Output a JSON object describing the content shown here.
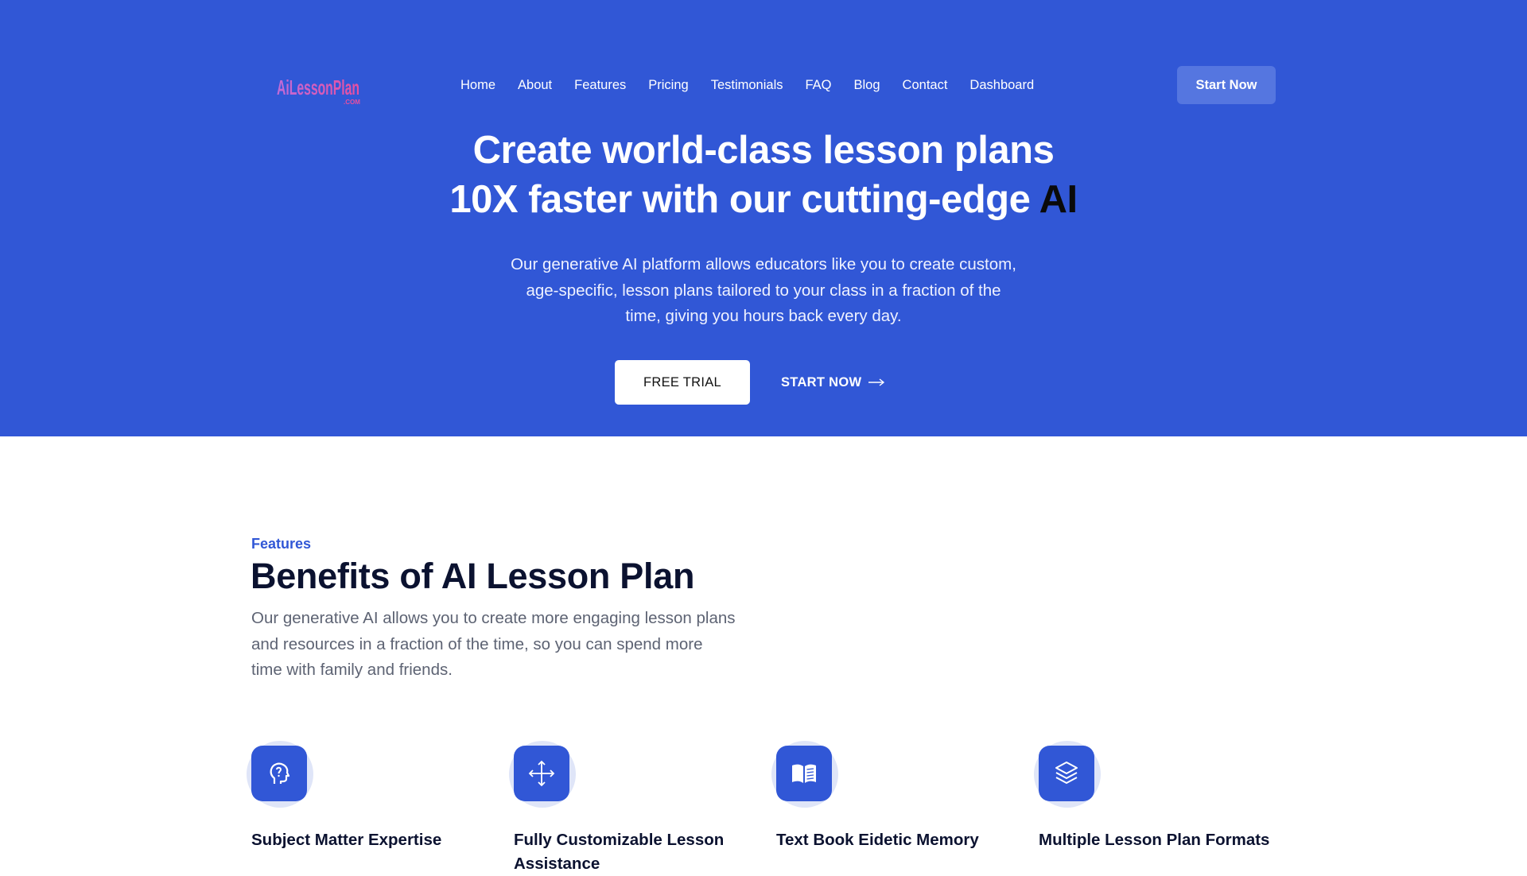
{
  "header": {
    "logo_text": "AiLessonPlan",
    "logo_sub": ".COM",
    "nav": [
      "Home",
      "About",
      "Features",
      "Pricing",
      "Testimonials",
      "FAQ",
      "Blog",
      "Contact",
      "Dashboard"
    ],
    "cta": "Start Now"
  },
  "hero": {
    "headline_line1": "Create world-class lesson plans",
    "headline_line2": "10X faster with our cutting-edge",
    "headline_highlight": "AI",
    "subtext": "Our generative AI platform allows educators like you to create custom, age-specific, lesson plans tailored to your class in a fraction of the time, giving you hours back every day.",
    "primary_button": "FREE TRIAL",
    "secondary_button": "START NOW"
  },
  "features": {
    "eyebrow": "Features",
    "title": "Benefits of AI Lesson Plan",
    "description": "Our generative AI allows you to create more engaging lesson plans and resources in a fraction of the time, so you can spend more time with family and friends.",
    "items": [
      {
        "title": "Subject Matter Expertise",
        "icon": "head-question-icon"
      },
      {
        "title": "Fully Customizable Lesson Assistance",
        "icon": "move-arrows-icon"
      },
      {
        "title": "Text Book Eidetic Memory",
        "icon": "open-book-icon"
      },
      {
        "title": "Multiple Lesson Plan Formats",
        "icon": "layers-icon"
      }
    ]
  },
  "colors": {
    "hero_bg": "#3157d6",
    "accent": "#3157d6",
    "heading": "#0b1230",
    "muted_text": "#5d6373"
  }
}
